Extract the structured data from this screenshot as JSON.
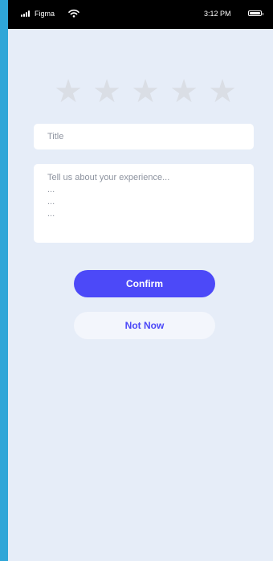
{
  "status_bar": {
    "carrier": "Figma",
    "time": "3:12 PM",
    "signal_icon": "signal-icon",
    "wifi_icon": "wifi-icon",
    "battery_icon": "battery-icon"
  },
  "rating": {
    "max": 5,
    "value": 0,
    "star_glyph": "★",
    "empty_color": "#dadee5"
  },
  "form": {
    "title_placeholder": "Title",
    "title_value": "",
    "experience_placeholder": "Tell us about your experience...\n...\n...\n...",
    "experience_value": ""
  },
  "actions": {
    "confirm_label": "Confirm",
    "not_now_label": "Not Now"
  },
  "colors": {
    "background": "#e6edf8",
    "accent": "#4c49f8",
    "secondary_button": "#f3f6fc",
    "side_stripe": "#2fa6d8"
  }
}
